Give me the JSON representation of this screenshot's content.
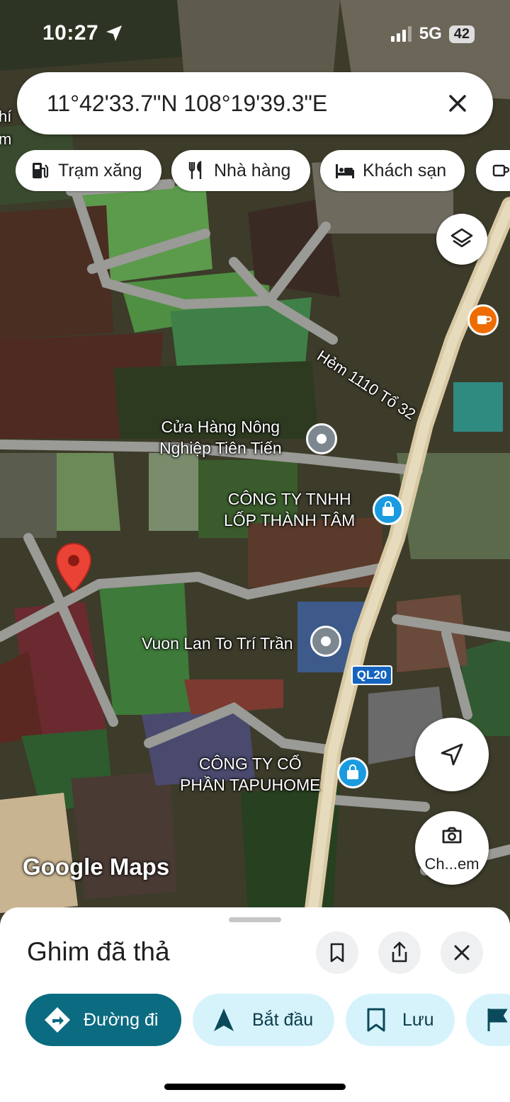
{
  "status": {
    "time": "10:27",
    "network": "5G",
    "battery": "42"
  },
  "search": {
    "query": "11°42'33.7\"N 108°19'39.3\"E"
  },
  "chips": [
    {
      "label": "Trạm xăng",
      "icon": "gas-station-icon"
    },
    {
      "label": "Nhà hàng",
      "icon": "restaurant-icon"
    },
    {
      "label": "Khách sạn",
      "icon": "hotel-icon"
    }
  ],
  "map": {
    "edge_labels": [
      "hí",
      "m"
    ],
    "street_label": "Hẻm 1110 Tổ 32",
    "road_shield": "QL20",
    "watermark": "Google Maps",
    "camera_label": "Ch...em",
    "places": [
      {
        "line1": "Cửa Hàng Nông",
        "line2": "Nghiệp Tiên Tiến",
        "type": "generic"
      },
      {
        "line1": "CÔNG TY TNHH",
        "line2": "LỐP THÀNH TÂM",
        "type": "shopping"
      },
      {
        "line1": "Vuon Lan To Trí Trần",
        "line2": "",
        "type": "generic"
      },
      {
        "line1": "CÔNG TY CỔ",
        "line2": "PHẦN TAPUHOME",
        "type": "shopping"
      }
    ]
  },
  "sheet": {
    "title": "Ghim đã thả",
    "actions": [
      {
        "label": "Đường đi",
        "primary": true,
        "icon": "directions-icon"
      },
      {
        "label": "Bắt đầu",
        "primary": false,
        "icon": "navigation-arrow-icon"
      },
      {
        "label": "Lưu",
        "primary": false,
        "icon": "bookmark-icon"
      }
    ]
  },
  "colors": {
    "primary": "#0b6b80",
    "tonal": "#d6f3fb",
    "pin": "#ea4335",
    "place_blue": "#1a9be0",
    "cafe_orange": "#ef6c00"
  }
}
